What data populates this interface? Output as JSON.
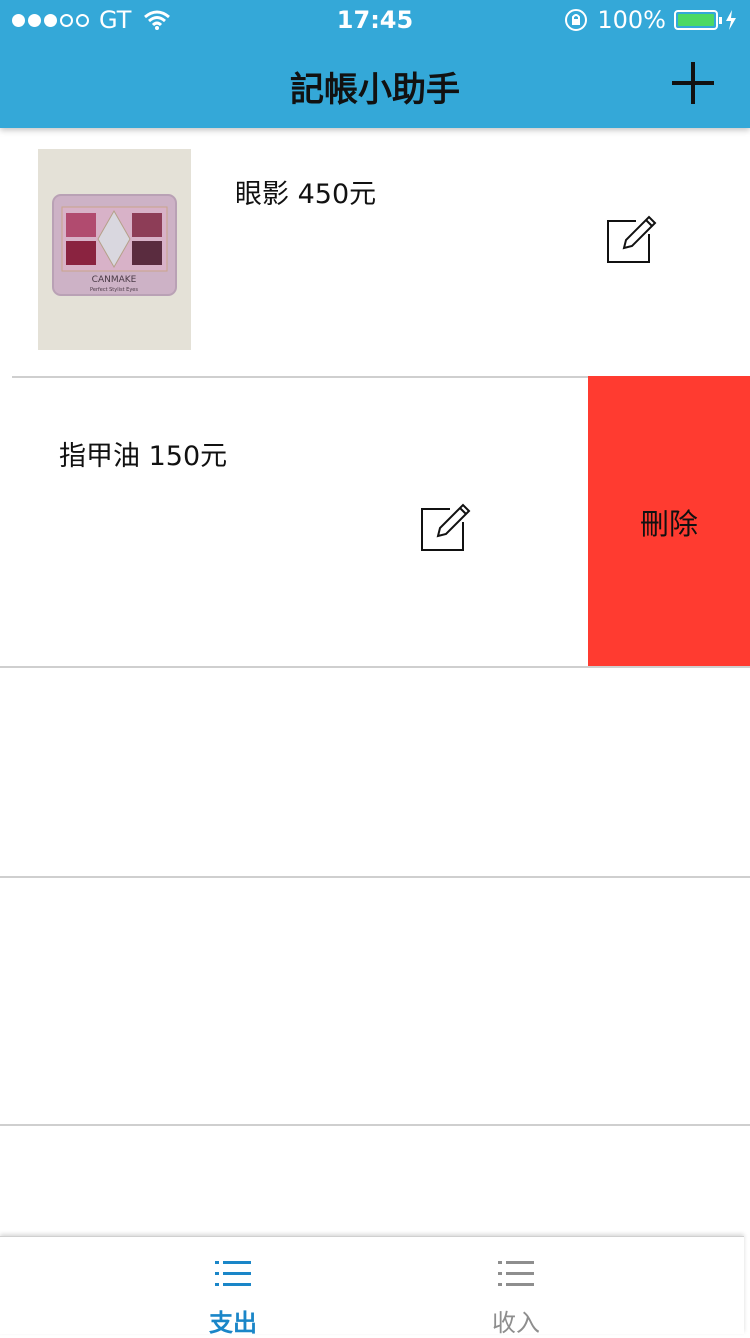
{
  "status_bar": {
    "carrier": "GT",
    "time": "17:45",
    "battery_percent": "100%",
    "signal_bars_filled": 3,
    "signal_bars_total": 5
  },
  "nav": {
    "title": "記帳小助手",
    "add_icon": "plus-icon"
  },
  "items": [
    {
      "text": "眼影 450元",
      "has_image": true,
      "image_desc_icon": "photo-thumbnail",
      "edit_icon": "edit-icon"
    },
    {
      "text": "指甲油 150元",
      "has_image": false,
      "edit_icon": "edit-icon",
      "delete_label": "刪除"
    }
  ],
  "thumbnail": {
    "brand": "CANMAKE",
    "subtitle": "Perfect Stylist Eyes"
  },
  "tabs": [
    {
      "label": "支出",
      "icon": "list-icon",
      "active": true
    },
    {
      "label": "收入",
      "icon": "list-icon",
      "active": false
    }
  ],
  "colors": {
    "header": "#34a8d8",
    "delete": "#ff3b30",
    "tab_active": "#1a86c8",
    "tab_inactive": "#8e8e8e",
    "battery": "#4cd964"
  }
}
